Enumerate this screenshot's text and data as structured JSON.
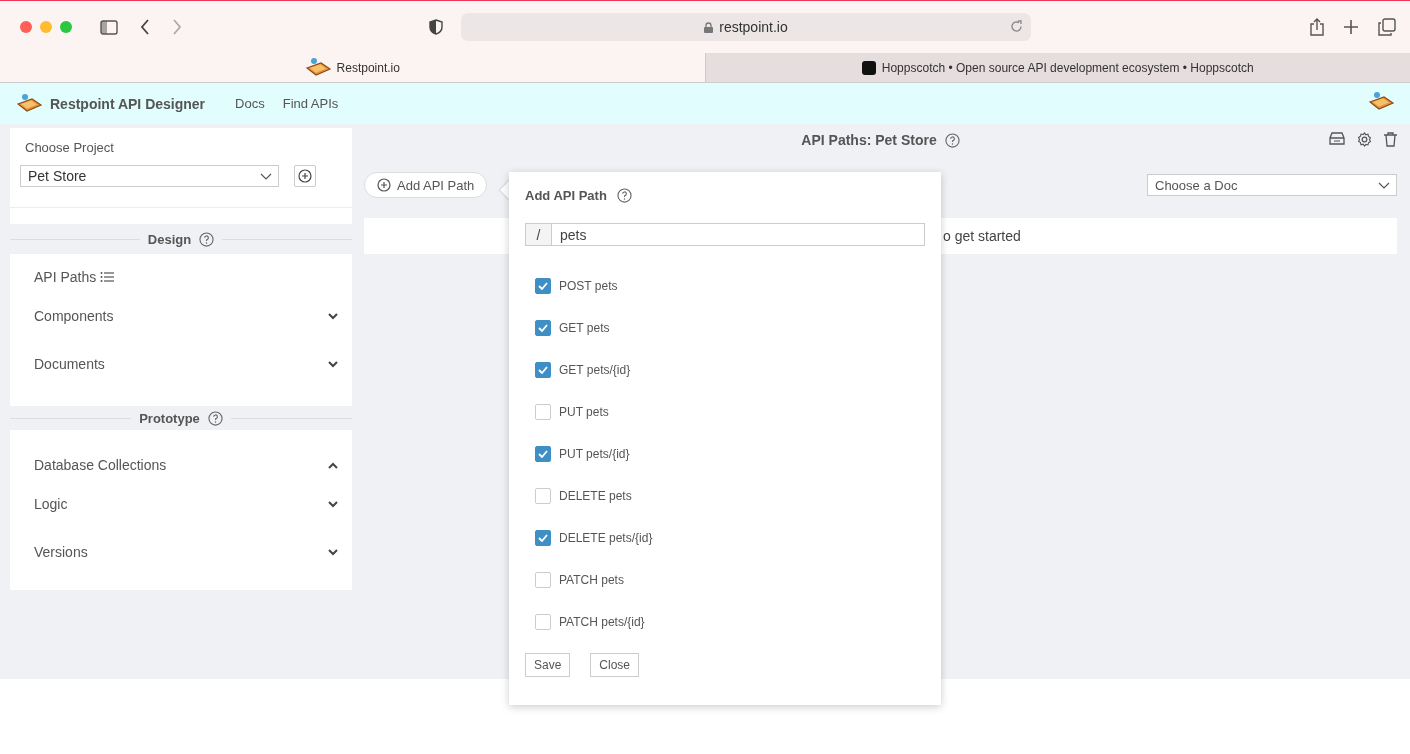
{
  "browser": {
    "address": "restpoint.io",
    "tabs": [
      {
        "title": "Restpoint.io",
        "selected": true
      },
      {
        "title": "Hoppscotch • Open source API development ecosystem • Hoppscotch",
        "selected": false
      }
    ]
  },
  "app_header": {
    "title": "Restpoint API Designer",
    "nav": [
      "Docs",
      "Find APIs"
    ]
  },
  "sidebar": {
    "project_label": "Choose Project",
    "project": "Pet Store",
    "design": {
      "title": "Design",
      "items": [
        {
          "kind": "link",
          "label": "API Paths"
        },
        {
          "kind": "accordion",
          "label": "Components",
          "expanded": false
        },
        {
          "kind": "accordion",
          "label": "Documents",
          "expanded": false
        }
      ]
    },
    "prototype": {
      "title": "Prototype",
      "items": [
        {
          "kind": "accordion",
          "label": "Database Collections",
          "expanded": true
        },
        {
          "kind": "accordion",
          "label": "Logic",
          "expanded": false
        },
        {
          "kind": "accordion",
          "label": "Versions",
          "expanded": false
        }
      ]
    }
  },
  "main": {
    "title": "API Paths: Pet Store",
    "add_button": "Add API Path",
    "doc_select": {
      "placeholder": "Choose a Doc"
    },
    "empty_message": "o get started"
  },
  "popover": {
    "title": "Add API Path",
    "prefix": "/",
    "path": "pets",
    "methods": [
      {
        "label": "POST pets",
        "checked": true
      },
      {
        "label": "GET pets",
        "checked": true
      },
      {
        "label": "GET pets/{id}",
        "checked": true
      },
      {
        "label": "PUT pets",
        "checked": false
      },
      {
        "label": "PUT pets/{id}",
        "checked": true
      },
      {
        "label": "DELETE pets",
        "checked": false
      },
      {
        "label": "DELETE pets/{id}",
        "checked": true
      },
      {
        "label": "PATCH pets",
        "checked": false
      },
      {
        "label": "PATCH pets/{id}",
        "checked": false
      }
    ],
    "buttons": [
      "Save",
      "Close"
    ]
  }
}
